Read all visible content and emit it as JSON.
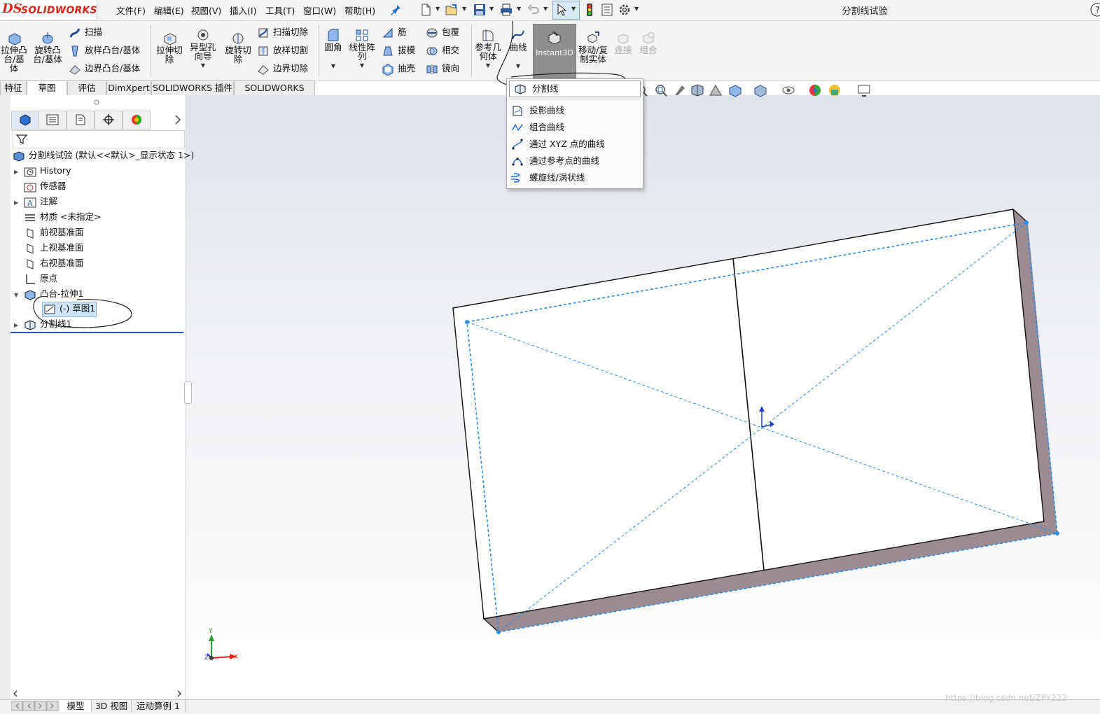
{
  "app": {
    "brand_mark": "DS",
    "brand_name": "SOLIDWORKS"
  },
  "menubar": [
    {
      "label": "文件(F)"
    },
    {
      "label": "编辑(E)"
    },
    {
      "label": "视图(V)"
    },
    {
      "label": "插入(I)"
    },
    {
      "label": "工具(T)"
    },
    {
      "label": "窗口(W)"
    },
    {
      "label": "帮助(H)"
    }
  ],
  "quick_access_icons": [
    "pin-icon",
    "new-document-icon",
    "open-icon",
    "save-icon",
    "print-icon",
    "undo-icon",
    "select-arrow-icon",
    "rebuild-traffic-light-icon",
    "file-properties-icon",
    "options-gear-icon"
  ],
  "document_title": "分割线试验",
  "ribbon": {
    "extrude_boss": "拉伸凸台/基体",
    "revolve_boss": "旋转凸台/基体",
    "sweep": "扫描",
    "loft_boss": "放样凸台/基体",
    "boundary_boss": "边界凸台/基体",
    "extrude_cut": "拉伸切除",
    "hole_wizard": "异型孔向导",
    "revolve_cut": "旋转切除",
    "swept_cut": "扫描切除",
    "lofted_cut": "放样切割",
    "boundary_cut": "边界切除",
    "fillet": "圆角",
    "linear_pattern": "线性阵列",
    "rib": "筋",
    "draft": "拔模",
    "shell": "抽壳",
    "wrap": "包覆",
    "intersect": "相交",
    "mirror": "镜向",
    "reference_geometry": "参考几何体",
    "curves": "曲线",
    "instant3d": "Instant3D",
    "move_copy": "移动/复制实体",
    "join": "连接",
    "combine": "组合"
  },
  "command_tabs": [
    {
      "label": "特征"
    },
    {
      "label": "草图"
    },
    {
      "label": "评估"
    },
    {
      "label": "DimXpert"
    },
    {
      "label": "SOLIDWORKS 插件"
    },
    {
      "label": "SOLIDWORKS MBD"
    }
  ],
  "curves_dropdown": [
    {
      "label": "分割线",
      "icon": "split-line-icon"
    },
    {
      "label": "投影曲线",
      "icon": "projected-curve-icon"
    },
    {
      "label": "组合曲线",
      "icon": "composite-curve-icon"
    },
    {
      "label": "通过 XYZ 点的曲线",
      "icon": "curve-through-xyz-icon"
    },
    {
      "label": "通过参考点的曲线",
      "icon": "curve-through-reference-points-icon"
    },
    {
      "label": "螺旋线/涡状线",
      "icon": "helix-spiral-icon"
    }
  ],
  "feature_tree": {
    "root": "分割线试验 (默认<<默认>_显示状态 1>)",
    "items": [
      {
        "label": "History",
        "icon": "history-folder-icon"
      },
      {
        "label": "传感器",
        "icon": "sensors-icon"
      },
      {
        "label": "注解",
        "icon": "annotations-icon"
      },
      {
        "label": "材质 <未指定>",
        "icon": "material-icon"
      },
      {
        "label": "前视基准面",
        "icon": "plane-icon"
      },
      {
        "label": "上视基准面",
        "icon": "plane-icon"
      },
      {
        "label": "右视基准面",
        "icon": "plane-icon"
      },
      {
        "label": "原点",
        "icon": "origin-icon"
      },
      {
        "label": "凸台-拉伸1",
        "icon": "extrude-feature-icon"
      },
      {
        "label": "(-) 草图1",
        "icon": "sketch-icon"
      },
      {
        "label": "分割线1",
        "icon": "split-line-feature-icon"
      }
    ]
  },
  "bottom_tabs": [
    {
      "label": "模型"
    },
    {
      "label": "3D 视图"
    },
    {
      "label": "运动算例 1"
    }
  ],
  "triad": {
    "x": "X",
    "y": "Y",
    "z": "Z"
  },
  "watermark": "https://blog.csdn.net/ZPY222",
  "colors": {
    "brand_red": "#d9261c",
    "sketch_blue": "#2f8be0",
    "part_side": "#9a8c92",
    "tree_selection": "#cde4fa",
    "instant3d_bg": "#8f8f8f"
  }
}
